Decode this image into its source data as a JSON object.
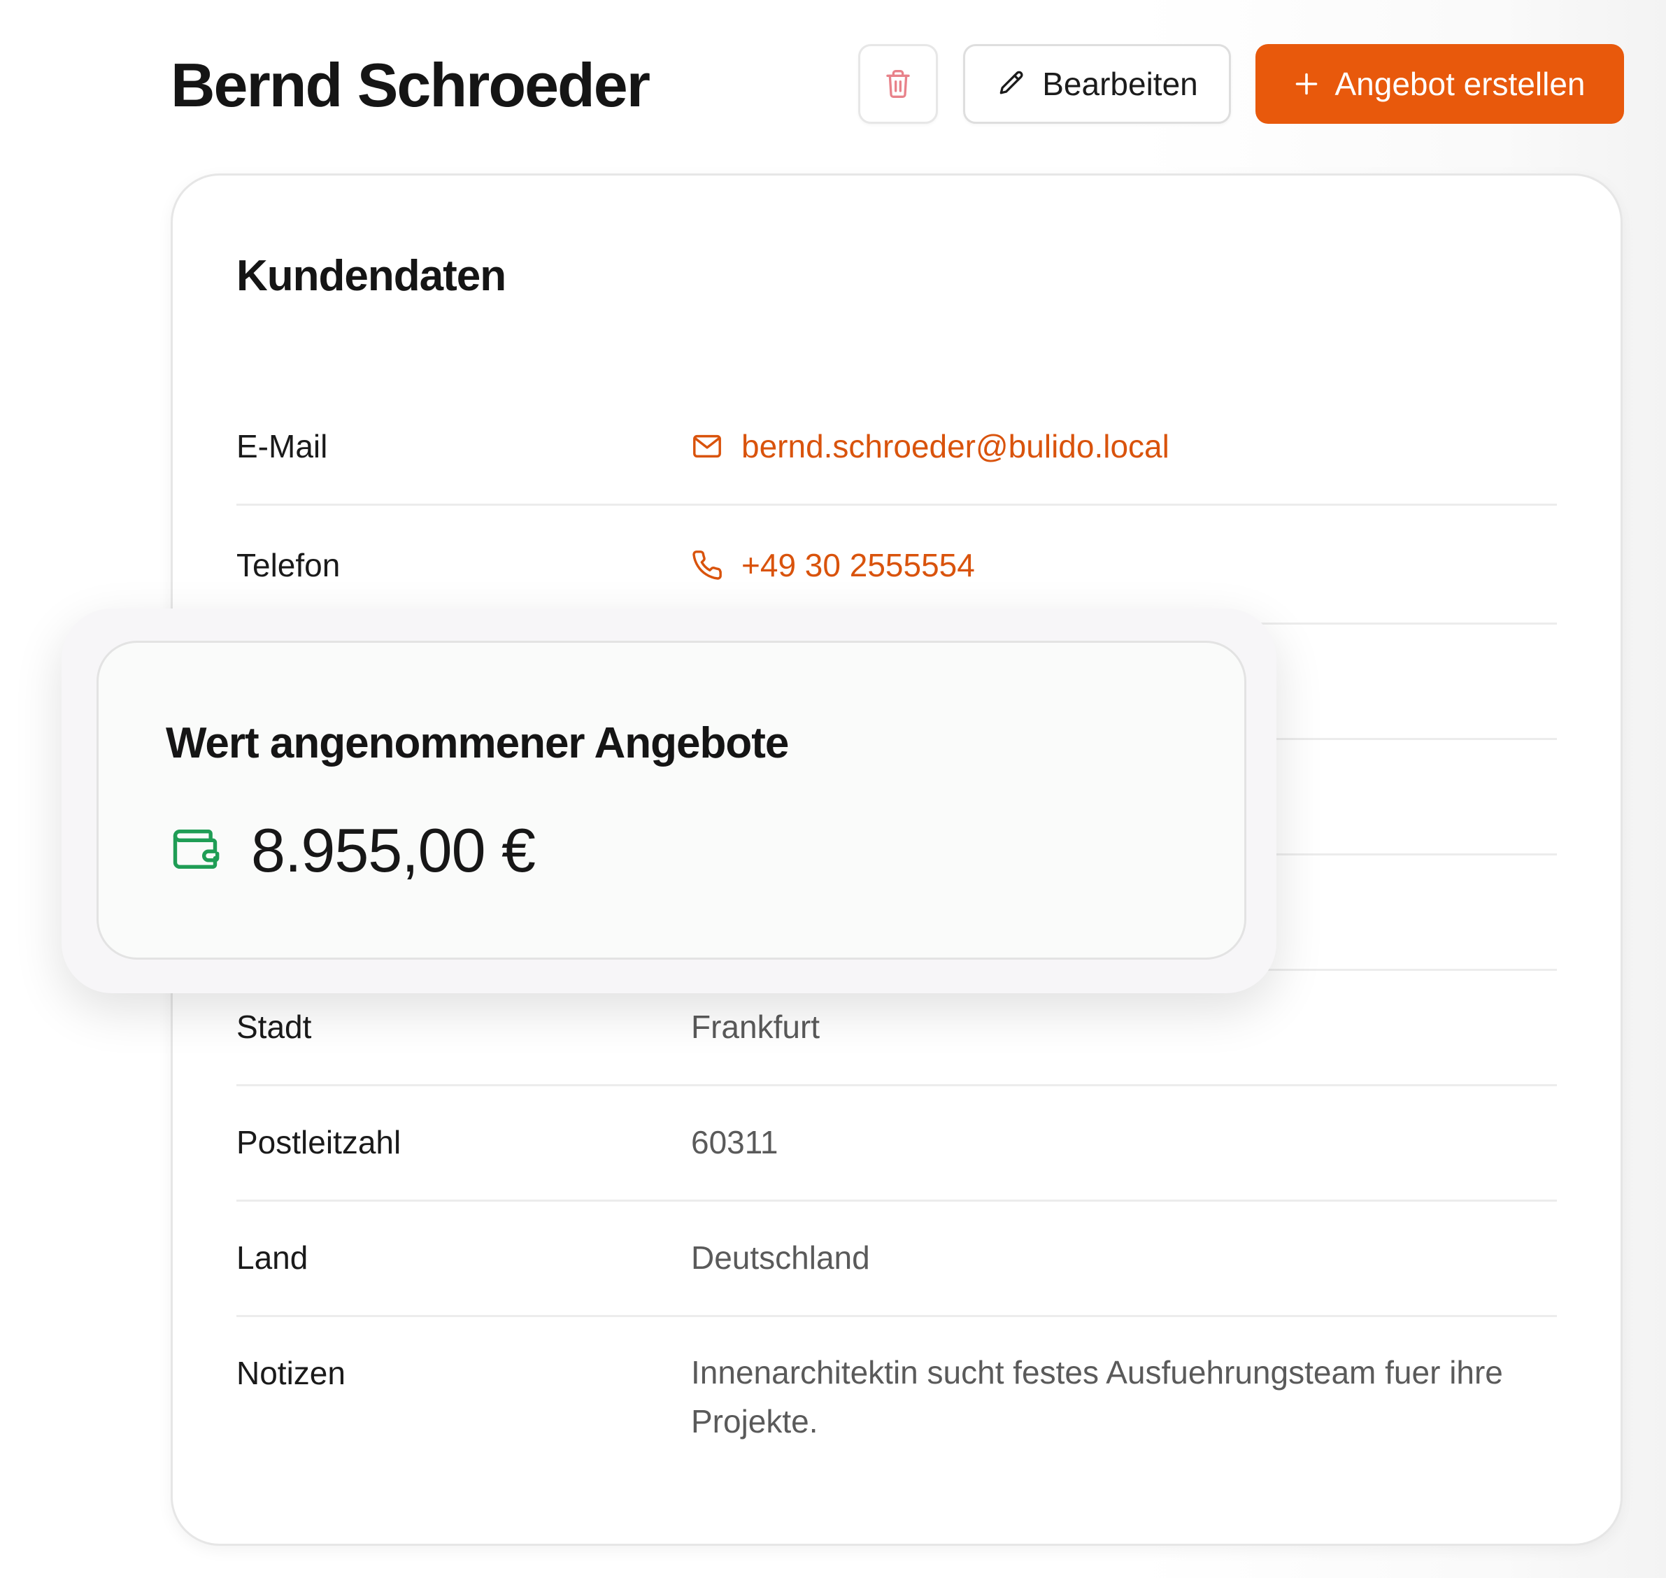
{
  "header": {
    "title": "Bernd Schroeder",
    "delete_icon": "trash-icon",
    "edit_label": "Bearbeiten",
    "edit_icon": "pencil-icon",
    "create_label": "Angebot erstellen",
    "create_icon": "plus-icon"
  },
  "customer_data": {
    "title": "Kundendaten",
    "rows": [
      {
        "label": "E-Mail",
        "value": "bernd.schroeder@bulido.local",
        "icon": "mail-icon"
      },
      {
        "label": "Telefon",
        "value": "+49 30 2555554",
        "icon": "phone-icon"
      },
      {
        "label": "Stadt",
        "value": "Frankfurt"
      },
      {
        "label": "Postleitzahl",
        "value": "60311"
      },
      {
        "label": "Land",
        "value": "Deutschland"
      },
      {
        "label": "Notizen",
        "value": "Innenarchitektin sucht festes Ausfuehrungsteam fuer ihre Projekte."
      }
    ]
  },
  "accepted_offers": {
    "title": "Wert angenommener Angebote",
    "value": "8.955,00 €",
    "icon": "wallet-icon"
  },
  "colors": {
    "accent": "#e8590c",
    "link": "#d9530c",
    "delete_icon": "#e8828a",
    "wallet": "#1f9d55",
    "text": "#151515",
    "muted_text": "#5a5a5a"
  }
}
